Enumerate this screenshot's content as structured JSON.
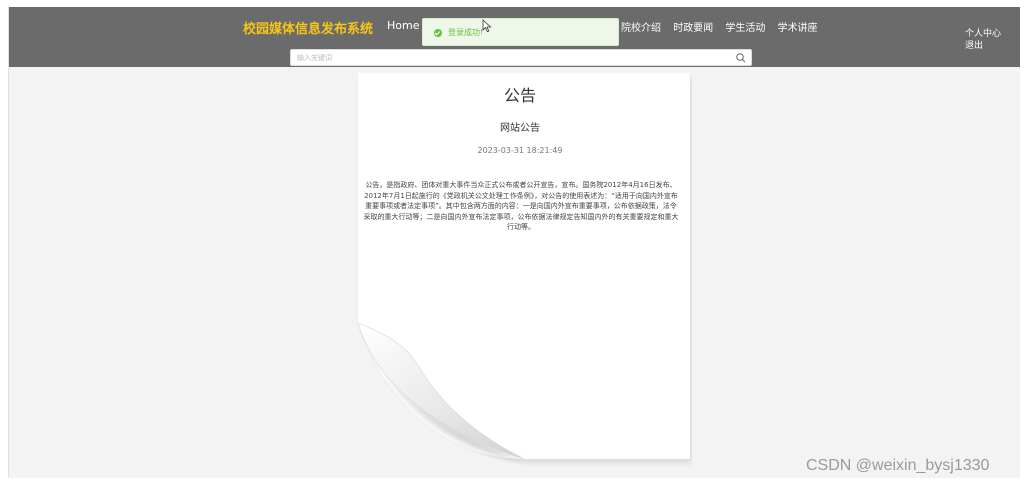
{
  "header": {
    "site_title": "校园媒体信息发布系统",
    "nav_home": "Home",
    "nav_items": [
      {
        "label": "院校介绍"
      },
      {
        "label": "时政要闻"
      },
      {
        "label": "学生活动"
      },
      {
        "label": "学术讲座"
      }
    ],
    "user_menu": {
      "profile_label": "个人中心",
      "logout_label": "退出"
    }
  },
  "toast": {
    "message": "登录成功!",
    "icon": "check-circle-icon",
    "color": "#67c23a"
  },
  "search": {
    "placeholder": "输入关键词",
    "icon": "search-icon"
  },
  "notice": {
    "heading": "公告",
    "title": "网站公告",
    "date": "2023-03-31 18:21:49",
    "body": "公告，是指政府、团体对重大事件当众正式公布或者公开宣告，宣布。国务院2012年4月16日发布、2012年7月1日起施行的《党政机关公文处理工作条例》，对公告的使用表述为：“适用于向国内外宣布重要事项或者法定事项”。其中包含两方面的内容：一是向国内外宣布重要事项，公布依据政策，法令采取的重大行动等；二是向国内外宣布法定事项，公布依据法律规定告知国内外的有关重要规定和重大行动等。"
  },
  "watermark": "CSDN @weixin_bysj1330",
  "colors": {
    "header_bg": "#6b6b6b",
    "title_color": "#f5c518",
    "page_bg": "#f3f3f3"
  }
}
